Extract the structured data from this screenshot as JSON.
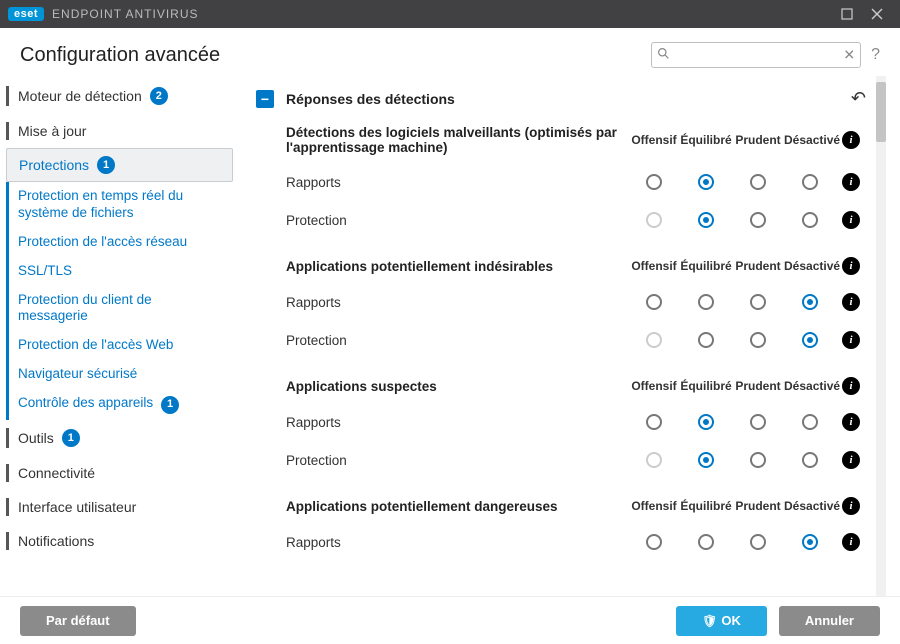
{
  "brand": {
    "logo": "eset",
    "product": "ENDPOINT ANTIVIRUS"
  },
  "header": {
    "title": "Configuration avancée"
  },
  "search": {
    "placeholder": ""
  },
  "sidebar": {
    "items": [
      {
        "label": "Moteur de détection",
        "badge": "2"
      },
      {
        "label": "Mise à jour"
      },
      {
        "label": "Protections",
        "badge": "1",
        "active": true,
        "children": [
          {
            "label": "Protection en temps réel du système de fichiers"
          },
          {
            "label": "Protection de l'accès réseau"
          },
          {
            "label": "SSL/TLS"
          },
          {
            "label": "Protection du client de messagerie"
          },
          {
            "label": "Protection de l'accès Web"
          },
          {
            "label": "Navigateur sécurisé"
          },
          {
            "label": "Contrôle des appareils",
            "badge": "1"
          }
        ]
      },
      {
        "label": "Outils",
        "badge": "1"
      },
      {
        "label": "Connectivité"
      },
      {
        "label": "Interface utilisateur"
      },
      {
        "label": "Notifications"
      }
    ]
  },
  "section": {
    "title": "Réponses des détections"
  },
  "columns": {
    "c1": "Offensif",
    "c2": "Équilibré",
    "c3": "Prudent",
    "c4": "Désactivé"
  },
  "groups": [
    {
      "title": "Détections des logiciels malveillants (optimisés par l'apprentissage machine)",
      "rows": [
        {
          "label": "Rapports",
          "sel": 1,
          "disabled": []
        },
        {
          "label": "Protection",
          "sel": 1,
          "disabled": [
            0
          ]
        }
      ]
    },
    {
      "title": "Applications potentiellement indésirables",
      "rows": [
        {
          "label": "Rapports",
          "sel": 3,
          "disabled": []
        },
        {
          "label": "Protection",
          "sel": 3,
          "disabled": [
            0
          ]
        }
      ]
    },
    {
      "title": "Applications suspectes",
      "rows": [
        {
          "label": "Rapports",
          "sel": 1,
          "disabled": []
        },
        {
          "label": "Protection",
          "sel": 1,
          "disabled": [
            0
          ]
        }
      ]
    },
    {
      "title": "Applications potentiellement dangereuses",
      "rows": [
        {
          "label": "Rapports",
          "sel": 3,
          "disabled": []
        }
      ]
    }
  ],
  "footer": {
    "default": "Par défaut",
    "ok": "OK",
    "cancel": "Annuler"
  }
}
